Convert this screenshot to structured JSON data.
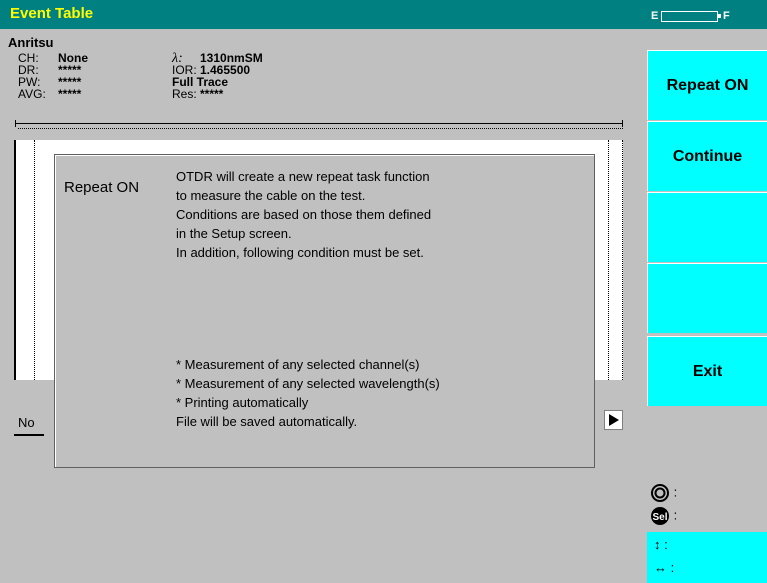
{
  "header": {
    "title": "Event Table",
    "battery_empty": "E",
    "battery_full": "F"
  },
  "brand": "Anritsu",
  "info": {
    "ch_label": "CH:",
    "ch_value": "None",
    "dr_label": "DR:",
    "dr_value": "*****",
    "pw_label": "PW:",
    "pw_value": "*****",
    "avg_label": "AVG:",
    "avg_value": "*****",
    "lambda_label": "λ:",
    "lambda_value": "1310nmSM",
    "ior_label": "IOR:",
    "ior_value": "1.465500",
    "trace_value": "Full Trace",
    "res_label": "Res:",
    "res_value": "*****"
  },
  "softkeys": {
    "k1": "Repeat ON",
    "k2": "Continue",
    "k3": "",
    "k4": "",
    "k5": "Exit"
  },
  "dialog": {
    "title": "Repeat ON",
    "lines": [
      "OTDR will create a new repeat task function",
      "to measure the cable on the test.",
      "Conditions are based on those them defined",
      "in the Setup screen.",
      "In addition, following condition must be set."
    ],
    "conditions": [
      "* Measurement of any selected channel(s)",
      "* Measurement of any selected wavelength(s)",
      "* Printing automatically",
      "File will be saved automatically."
    ]
  },
  "no_label": "No",
  "legend": {
    "rotary_sep": ":",
    "sel_sep": ":",
    "sel_text": "Sel",
    "vert_sep": ":",
    "horiz_sep": ":"
  }
}
